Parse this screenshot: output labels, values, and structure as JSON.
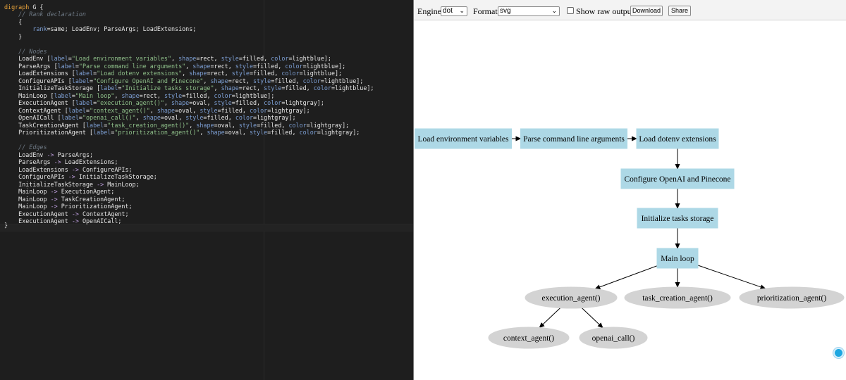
{
  "editor": {
    "lines": [
      [
        [
          "kw",
          "digraph"
        ],
        [
          "id",
          " G {"
        ]
      ],
      [
        [
          "cm",
          "    // Rank declaration"
        ]
      ],
      [
        [
          "id",
          "    {"
        ]
      ],
      [
        [
          "id",
          "        "
        ],
        [
          "at",
          "rank"
        ],
        [
          "id",
          "=same; LoadEnv; ParseArgs; LoadExtensions;"
        ]
      ],
      [
        [
          "id",
          "    }"
        ]
      ],
      [
        [
          "id",
          ""
        ]
      ],
      [
        [
          "cm",
          "    // Nodes"
        ]
      ],
      [
        [
          "id",
          "    LoadEnv ["
        ],
        [
          "at",
          "label"
        ],
        [
          "id",
          "="
        ],
        [
          "str",
          "\"Load environment variables\""
        ],
        [
          "id",
          ", "
        ],
        [
          "at",
          "shape"
        ],
        [
          "id",
          "=rect, "
        ],
        [
          "at",
          "style"
        ],
        [
          "id",
          "=filled, "
        ],
        [
          "at",
          "color"
        ],
        [
          "id",
          "=lightblue];"
        ]
      ],
      [
        [
          "id",
          "    ParseArgs ["
        ],
        [
          "at",
          "label"
        ],
        [
          "id",
          "="
        ],
        [
          "str",
          "\"Parse command line arguments\""
        ],
        [
          "id",
          ", "
        ],
        [
          "at",
          "shape"
        ],
        [
          "id",
          "=rect, "
        ],
        [
          "at",
          "style"
        ],
        [
          "id",
          "=filled, "
        ],
        [
          "at",
          "color"
        ],
        [
          "id",
          "=lightblue];"
        ]
      ],
      [
        [
          "id",
          "    LoadExtensions ["
        ],
        [
          "at",
          "label"
        ],
        [
          "id",
          "="
        ],
        [
          "str",
          "\"Load dotenv extensions\""
        ],
        [
          "id",
          ", "
        ],
        [
          "at",
          "shape"
        ],
        [
          "id",
          "=rect, "
        ],
        [
          "at",
          "style"
        ],
        [
          "id",
          "=filled, "
        ],
        [
          "at",
          "color"
        ],
        [
          "id",
          "=lightblue];"
        ]
      ],
      [
        [
          "id",
          "    ConfigureAPIs ["
        ],
        [
          "at",
          "label"
        ],
        [
          "id",
          "="
        ],
        [
          "str",
          "\"Configure OpenAI and Pinecone\""
        ],
        [
          "id",
          ", "
        ],
        [
          "at",
          "shape"
        ],
        [
          "id",
          "=rect, "
        ],
        [
          "at",
          "style"
        ],
        [
          "id",
          "=filled, "
        ],
        [
          "at",
          "color"
        ],
        [
          "id",
          "=lightblue];"
        ]
      ],
      [
        [
          "id",
          "    InitializeTaskStorage ["
        ],
        [
          "at",
          "label"
        ],
        [
          "id",
          "="
        ],
        [
          "str",
          "\"Initialize tasks storage\""
        ],
        [
          "id",
          ", "
        ],
        [
          "at",
          "shape"
        ],
        [
          "id",
          "=rect, "
        ],
        [
          "at",
          "style"
        ],
        [
          "id",
          "=filled, "
        ],
        [
          "at",
          "color"
        ],
        [
          "id",
          "=lightblue];"
        ]
      ],
      [
        [
          "id",
          "    MainLoop ["
        ],
        [
          "at",
          "label"
        ],
        [
          "id",
          "="
        ],
        [
          "str",
          "\"Main loop\""
        ],
        [
          "id",
          ", "
        ],
        [
          "at",
          "shape"
        ],
        [
          "id",
          "=rect, "
        ],
        [
          "at",
          "style"
        ],
        [
          "id",
          "=filled, "
        ],
        [
          "at",
          "color"
        ],
        [
          "id",
          "=lightblue];"
        ]
      ],
      [
        [
          "id",
          "    ExecutionAgent ["
        ],
        [
          "at",
          "label"
        ],
        [
          "id",
          "="
        ],
        [
          "str",
          "\"execution_agent()\""
        ],
        [
          "id",
          ", "
        ],
        [
          "at",
          "shape"
        ],
        [
          "id",
          "=oval, "
        ],
        [
          "at",
          "style"
        ],
        [
          "id",
          "=filled, "
        ],
        [
          "at",
          "color"
        ],
        [
          "id",
          "=lightgray];"
        ]
      ],
      [
        [
          "id",
          "    ContextAgent ["
        ],
        [
          "at",
          "label"
        ],
        [
          "id",
          "="
        ],
        [
          "str",
          "\"context_agent()\""
        ],
        [
          "id",
          ", "
        ],
        [
          "at",
          "shape"
        ],
        [
          "id",
          "=oval, "
        ],
        [
          "at",
          "style"
        ],
        [
          "id",
          "=filled, "
        ],
        [
          "at",
          "color"
        ],
        [
          "id",
          "=lightgray];"
        ]
      ],
      [
        [
          "id",
          "    OpenAICall ["
        ],
        [
          "at",
          "label"
        ],
        [
          "id",
          "="
        ],
        [
          "str",
          "\"openai_call()\""
        ],
        [
          "id",
          ", "
        ],
        [
          "at",
          "shape"
        ],
        [
          "id",
          "=oval, "
        ],
        [
          "at",
          "style"
        ],
        [
          "id",
          "=filled, "
        ],
        [
          "at",
          "color"
        ],
        [
          "id",
          "=lightgray];"
        ]
      ],
      [
        [
          "id",
          "    TaskCreationAgent ["
        ],
        [
          "at",
          "label"
        ],
        [
          "id",
          "="
        ],
        [
          "str",
          "\"task_creation_agent()\""
        ],
        [
          "id",
          ", "
        ],
        [
          "at",
          "shape"
        ],
        [
          "id",
          "=oval, "
        ],
        [
          "at",
          "style"
        ],
        [
          "id",
          "=filled, "
        ],
        [
          "at",
          "color"
        ],
        [
          "id",
          "=lightgray];"
        ]
      ],
      [
        [
          "id",
          "    PrioritizationAgent ["
        ],
        [
          "at",
          "label"
        ],
        [
          "id",
          "="
        ],
        [
          "str",
          "\"prioritization_agent()\""
        ],
        [
          "id",
          ", "
        ],
        [
          "at",
          "shape"
        ],
        [
          "id",
          "=oval, "
        ],
        [
          "at",
          "style"
        ],
        [
          "id",
          "=filled, "
        ],
        [
          "at",
          "color"
        ],
        [
          "id",
          "=lightgray];"
        ]
      ],
      [
        [
          "id",
          ""
        ]
      ],
      [
        [
          "cm",
          "    // Edges"
        ]
      ],
      [
        [
          "id",
          "    LoadEnv "
        ],
        [
          "ar",
          "->"
        ],
        [
          "id",
          " ParseArgs;"
        ]
      ],
      [
        [
          "id",
          "    ParseArgs "
        ],
        [
          "ar",
          "->"
        ],
        [
          "id",
          " LoadExtensions;"
        ]
      ],
      [
        [
          "id",
          "    LoadExtensions "
        ],
        [
          "ar",
          "->"
        ],
        [
          "id",
          " ConfigureAPIs;"
        ]
      ],
      [
        [
          "id",
          "    ConfigureAPIs "
        ],
        [
          "ar",
          "->"
        ],
        [
          "id",
          " InitializeTaskStorage;"
        ]
      ],
      [
        [
          "id",
          "    InitializeTaskStorage "
        ],
        [
          "ar",
          "->"
        ],
        [
          "id",
          " MainLoop;"
        ]
      ],
      [
        [
          "id",
          "    MainLoop "
        ],
        [
          "ar",
          "->"
        ],
        [
          "id",
          " ExecutionAgent;"
        ]
      ],
      [
        [
          "id",
          "    MainLoop "
        ],
        [
          "ar",
          "->"
        ],
        [
          "id",
          " TaskCreationAgent;"
        ]
      ],
      [
        [
          "id",
          "    MainLoop "
        ],
        [
          "ar",
          "->"
        ],
        [
          "id",
          " PrioritizationAgent;"
        ]
      ],
      [
        [
          "id",
          "    ExecutionAgent "
        ],
        [
          "ar",
          "->"
        ],
        [
          "id",
          " ContextAgent;"
        ]
      ],
      [
        [
          "id",
          "    ExecutionAgent "
        ],
        [
          "ar",
          "->"
        ],
        [
          "id",
          " OpenAICall;"
        ]
      ],
      [
        [
          "id",
          "}"
        ]
      ]
    ]
  },
  "toolbar": {
    "engine_label": "Engine:",
    "engine_value": "dot",
    "format_label": "Format:",
    "format_value": "svg",
    "raw_output_label": "Show raw output",
    "raw_output_checked": false,
    "download_label": "Download",
    "share_label": "Share",
    "dropdown_icon": "chevron-down-icon"
  },
  "graph": {
    "nodes": [
      {
        "id": "LoadEnv",
        "label": "Load environment variables",
        "shape": "rect",
        "color": "#add8e6"
      },
      {
        "id": "ParseArgs",
        "label": "Parse command line arguments",
        "shape": "rect",
        "color": "#add8e6"
      },
      {
        "id": "LoadExtensions",
        "label": "Load dotenv extensions",
        "shape": "rect",
        "color": "#add8e6"
      },
      {
        "id": "ConfigureAPIs",
        "label": "Configure OpenAI and Pinecone",
        "shape": "rect",
        "color": "#add8e6"
      },
      {
        "id": "InitializeTaskStorage",
        "label": "Initialize tasks storage",
        "shape": "rect",
        "color": "#add8e6"
      },
      {
        "id": "MainLoop",
        "label": "Main loop",
        "shape": "rect",
        "color": "#add8e6"
      },
      {
        "id": "ExecutionAgent",
        "label": "execution_agent()",
        "shape": "oval",
        "color": "#d3d3d3"
      },
      {
        "id": "TaskCreationAgent",
        "label": "task_creation_agent()",
        "shape": "oval",
        "color": "#d3d3d3"
      },
      {
        "id": "PrioritizationAgent",
        "label": "prioritization_agent()",
        "shape": "oval",
        "color": "#d3d3d3"
      },
      {
        "id": "ContextAgent",
        "label": "context_agent()",
        "shape": "oval",
        "color": "#d3d3d3"
      },
      {
        "id": "OpenAICall",
        "label": "openai_call()",
        "shape": "oval",
        "color": "#d3d3d3"
      }
    ],
    "edges": [
      [
        "LoadEnv",
        "ParseArgs"
      ],
      [
        "ParseArgs",
        "LoadExtensions"
      ],
      [
        "LoadExtensions",
        "ConfigureAPIs"
      ],
      [
        "ConfigureAPIs",
        "InitializeTaskStorage"
      ],
      [
        "InitializeTaskStorage",
        "MainLoop"
      ],
      [
        "MainLoop",
        "ExecutionAgent"
      ],
      [
        "MainLoop",
        "TaskCreationAgent"
      ],
      [
        "MainLoop",
        "PrioritizationAgent"
      ],
      [
        "ExecutionAgent",
        "ContextAgent"
      ],
      [
        "ExecutionAgent",
        "OpenAICall"
      ]
    ]
  },
  "colors": {
    "editor_bg": "#1e1e1e",
    "node_blue": "#add8e6",
    "node_gray": "#d3d3d3",
    "accent": "#1ea7e1"
  },
  "floating_button": {
    "icon": "help-bubble-icon"
  }
}
